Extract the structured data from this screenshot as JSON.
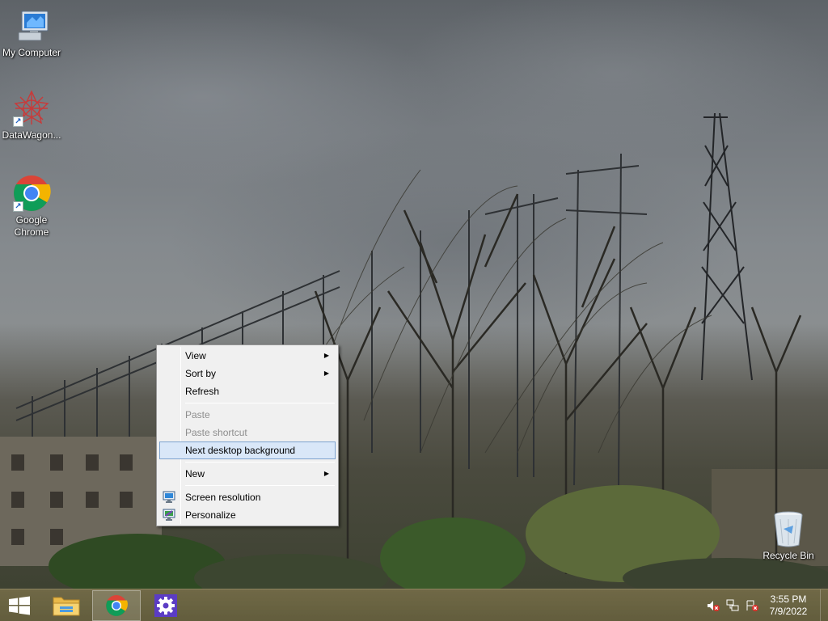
{
  "desktop": {
    "icons": [
      {
        "label": "My Computer",
        "icon": "computer-icon"
      },
      {
        "label": "DataWagon...",
        "icon": "datawagon-icon"
      },
      {
        "label": "Google Chrome",
        "icon": "chrome-icon"
      },
      {
        "label": "Recycle Bin",
        "icon": "recycle-bin-icon"
      }
    ]
  },
  "context_menu": {
    "items": [
      {
        "label": "View",
        "submenu": true,
        "enabled": true
      },
      {
        "label": "Sort by",
        "submenu": true,
        "enabled": true
      },
      {
        "label": "Refresh",
        "submenu": false,
        "enabled": true
      },
      {
        "label": "Paste",
        "submenu": false,
        "enabled": false
      },
      {
        "label": "Paste shortcut",
        "submenu": false,
        "enabled": false
      },
      {
        "label": "Next desktop background",
        "submenu": false,
        "enabled": true,
        "highlighted": true
      },
      {
        "label": "New",
        "submenu": true,
        "enabled": true
      },
      {
        "label": "Screen resolution",
        "submenu": false,
        "enabled": true,
        "icon": "screen-resolution-icon"
      },
      {
        "label": "Personalize",
        "submenu": false,
        "enabled": true,
        "icon": "personalize-icon"
      }
    ]
  },
  "taskbar": {
    "start_icon": "windows-logo-icon",
    "pinned": [
      {
        "name": "File Explorer",
        "icon": "folder-icon"
      },
      {
        "name": "Google Chrome",
        "icon": "chrome-icon",
        "active": true
      },
      {
        "name": "Settings",
        "icon": "gear-icon"
      }
    ],
    "tray": [
      "speaker-muted-icon",
      "network-icon",
      "action-center-icon"
    ],
    "clock": {
      "time": "3:55 PM",
      "date": "7/9/2022"
    }
  },
  "colors": {
    "menu_bg": "#f0f0f0",
    "menu_highlight": "#d9e7f8",
    "menu_highlight_border": "#7da2ce",
    "disabled_text": "#8d8d8d",
    "taskbar": "#6a6340"
  }
}
